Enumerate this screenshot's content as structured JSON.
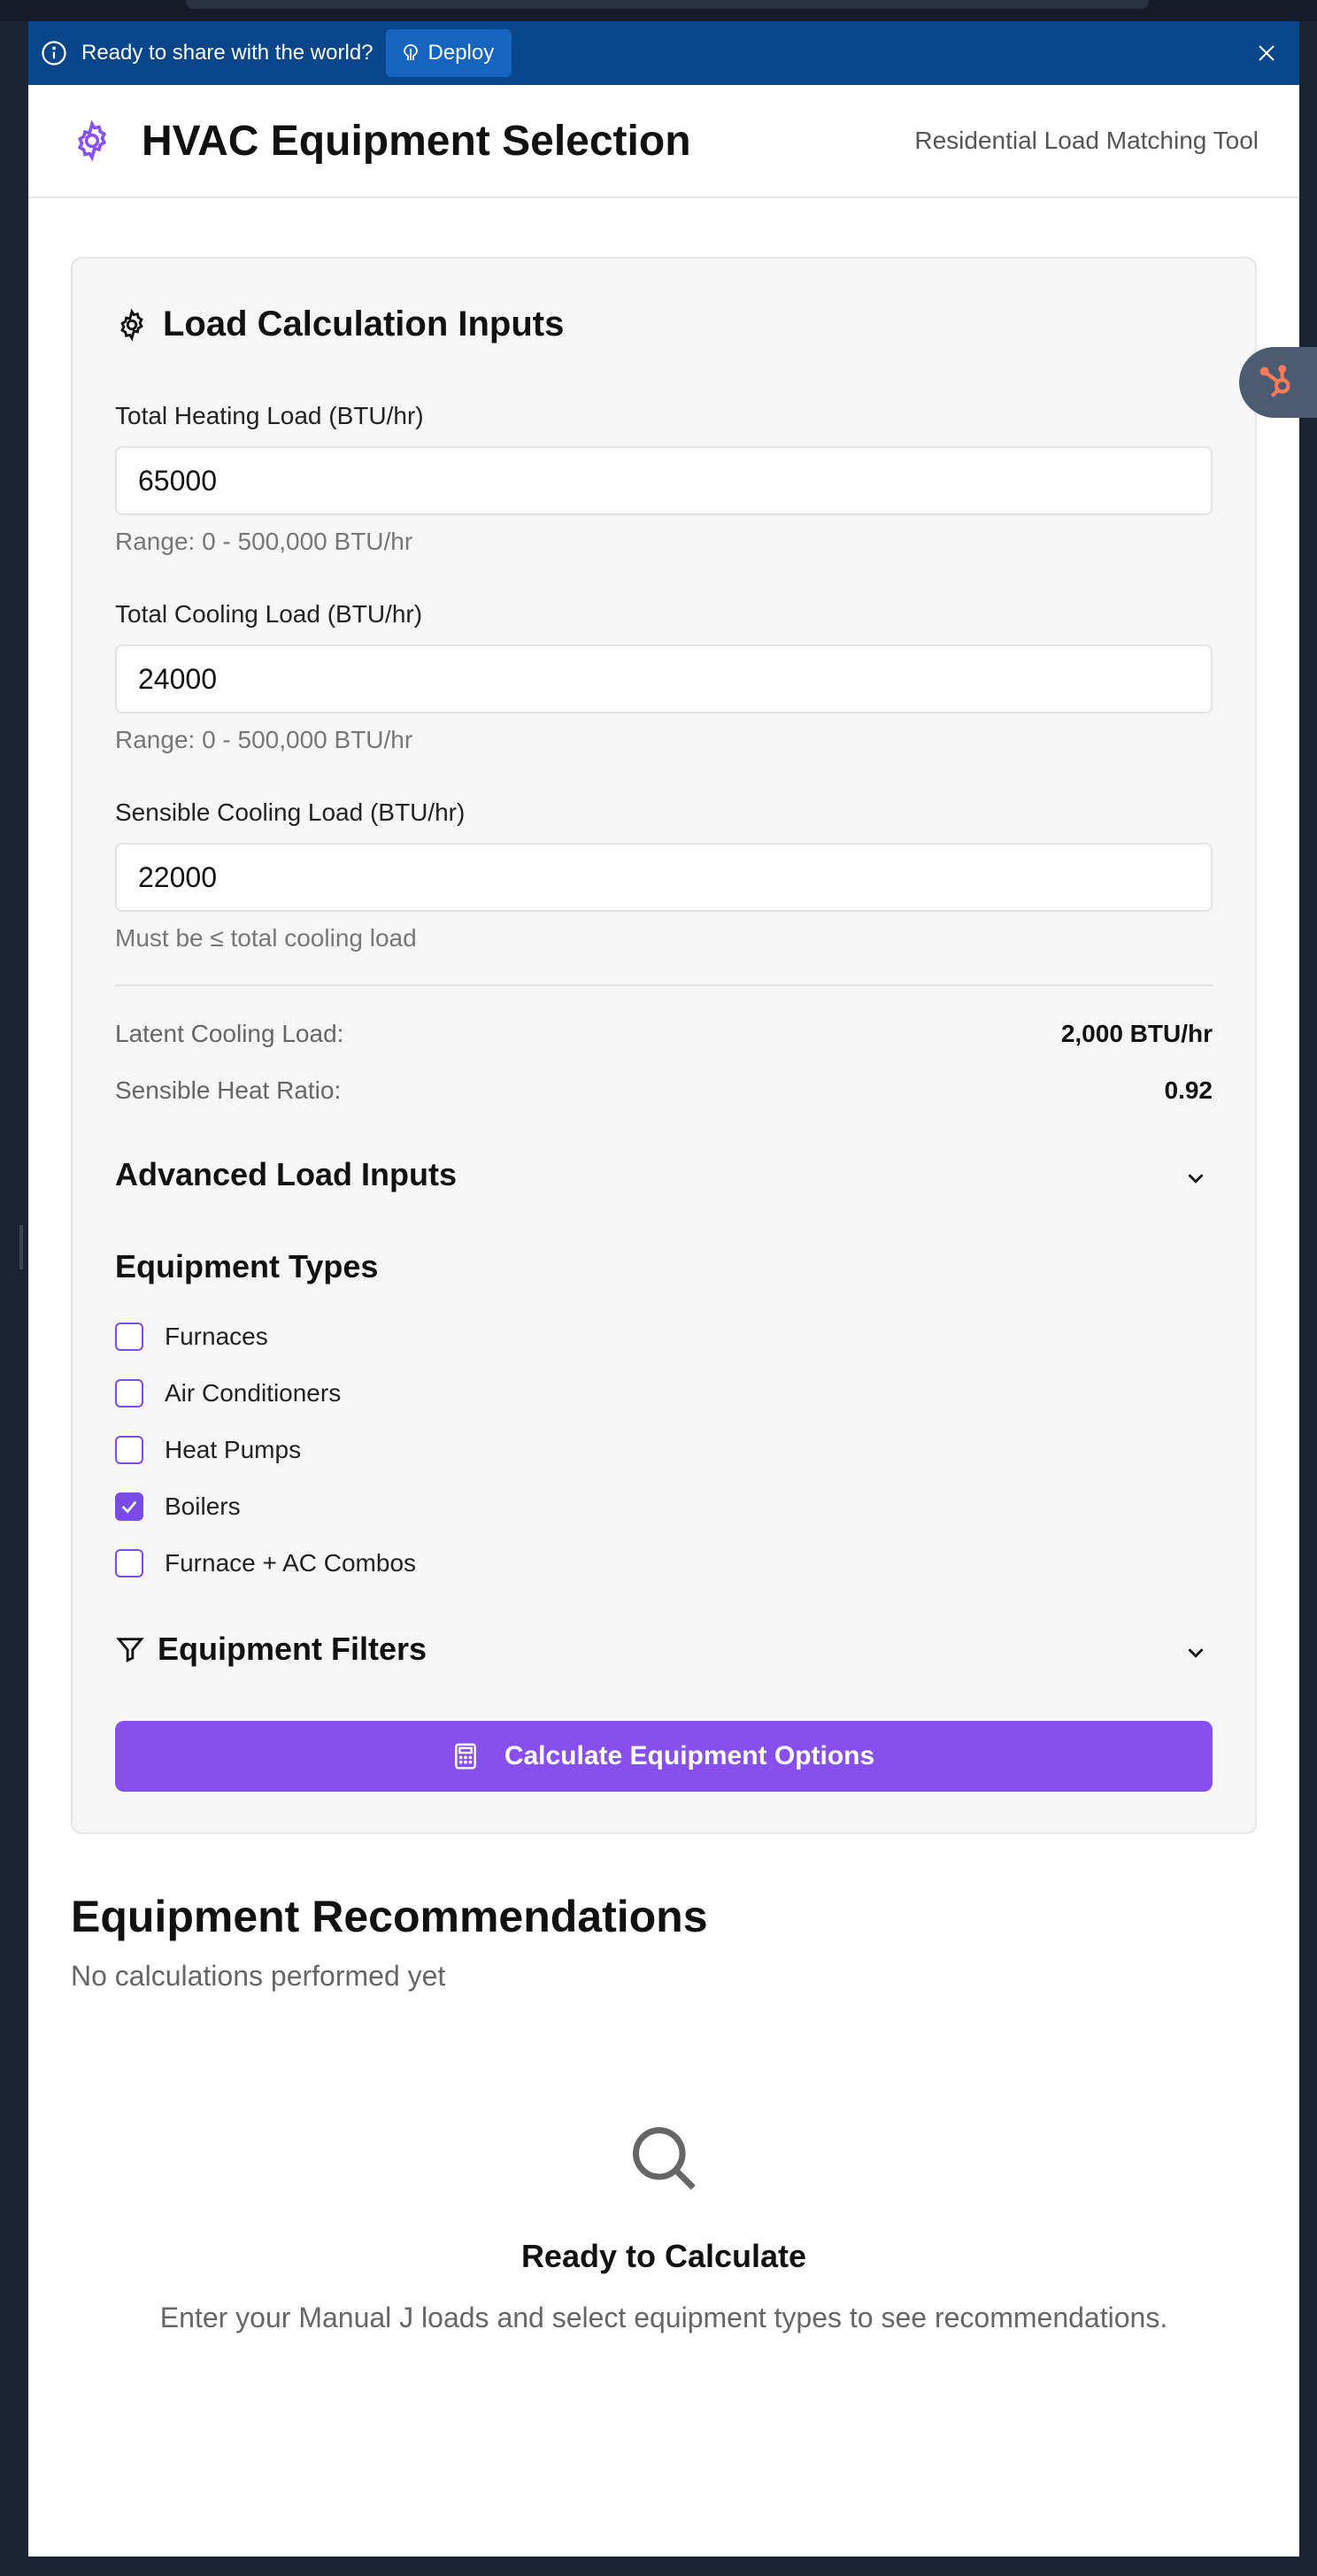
{
  "banner": {
    "message": "Ready to share with the world?",
    "deploy_label": "Deploy"
  },
  "header": {
    "title": "HVAC Equipment Selection",
    "subtitle": "Residential Load Matching Tool"
  },
  "inputs_card": {
    "title": "Load Calculation Inputs",
    "heating": {
      "label": "Total Heating Load (BTU/hr)",
      "value": "65000",
      "hint": "Range: 0 - 500,000 BTU/hr"
    },
    "cooling": {
      "label": "Total Cooling Load (BTU/hr)",
      "value": "24000",
      "hint": "Range: 0 - 500,000 BTU/hr"
    },
    "sensible": {
      "label": "Sensible Cooling Load (BTU/hr)",
      "value": "22000",
      "hint": "Must be ≤ total cooling load"
    },
    "latent": {
      "label": "Latent Cooling Load:",
      "value": "2,000 BTU/hr"
    },
    "shr": {
      "label": "Sensible Heat Ratio:",
      "value": "0.92"
    },
    "advanced_title": "Advanced Load Inputs",
    "equipment_types_title": "Equipment Types",
    "equipment_types": [
      {
        "label": "Furnaces",
        "checked": false
      },
      {
        "label": "Air Conditioners",
        "checked": false
      },
      {
        "label": "Heat Pumps",
        "checked": false
      },
      {
        "label": "Boilers",
        "checked": true
      },
      {
        "label": "Furnace + AC Combos",
        "checked": false
      }
    ],
    "filters_title": "Equipment Filters",
    "calculate_label": "Calculate Equipment Options"
  },
  "recommendations": {
    "title": "Equipment Recommendations",
    "subtitle": "No calculations performed yet",
    "empty_title": "Ready to Calculate",
    "empty_desc": "Enter your Manual J loads and select equipment types to see recommendations."
  },
  "colors": {
    "accent": "#8750ee",
    "banner": "#07468a",
    "hubspot": "#ff7a59"
  }
}
